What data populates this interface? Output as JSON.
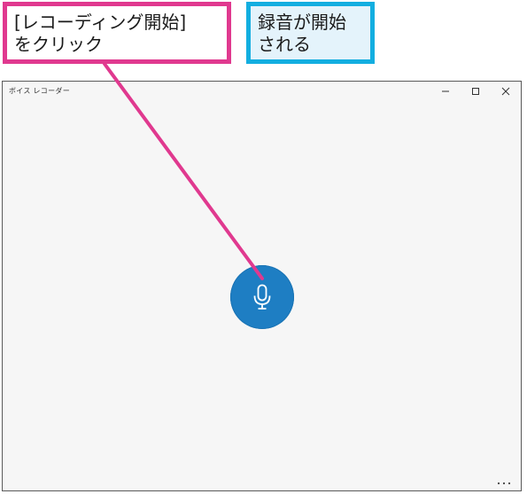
{
  "callouts": {
    "click_instruction": "[レコーディング開始]\nをクリック",
    "result_note": "録音が開始\nされる"
  },
  "window": {
    "title": "ボイス レコーダー",
    "controls": [
      "minimize-icon",
      "maximize-icon",
      "close-icon"
    ]
  },
  "main": {
    "record_button_icon": "microphone-icon",
    "more_icon": "ellipsis-icon"
  },
  "colors": {
    "callout_pink": "#e0398f",
    "callout_blue": "#13aee0",
    "record_button": "#1e7ec3",
    "window_bg": "#f6f6f6"
  }
}
